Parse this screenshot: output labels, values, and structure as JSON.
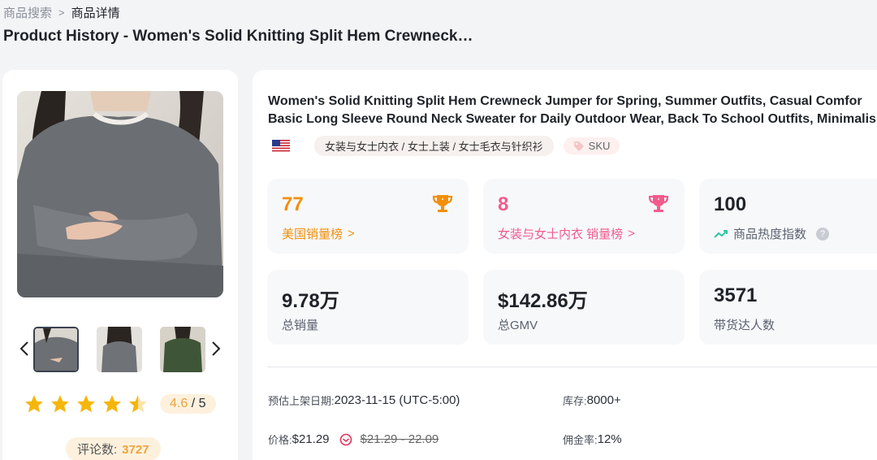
{
  "breadcrumb": {
    "parent": "商品搜索",
    "separator": ">",
    "current": "商品详情"
  },
  "page_title": "Product History - Women's Solid Knitting Split Hem Crewneck…",
  "gallery": {
    "rating": "4.6",
    "rating_total": "/ 5",
    "stars_filled": 4.5,
    "review_label": "评论数:",
    "review_count": "3727",
    "thumb_count": 3,
    "active_thumb_index": 0,
    "star_color": "#f5b60a"
  },
  "product": {
    "name_line1": "Women's Solid Knitting Split Hem Crewneck Jumper for Spring, Summer Outfits, Casual Comfor",
    "name_line2": "Basic Long Sleeve Round Neck Sweater for Daily Outdoor Wear, Back To School Outfits, Minimalis",
    "flag": "us-flag-icon",
    "category": "女装与女士内衣 / 女士上装 / 女士毛衣与针织衫",
    "sku_label": "SKU"
  },
  "stats": {
    "rank_us": {
      "value": "77",
      "label": "美国销量榜",
      "arrow": ">",
      "color": "#f38f0c"
    },
    "rank_category": {
      "value": "8",
      "label": "女装与女士内衣 销量榜",
      "arrow": ">",
      "color": "#f25c8c"
    },
    "heat": {
      "value": "100",
      "label": "商品热度指数",
      "help": "?"
    },
    "total_sales": {
      "value": "9.78万",
      "label": "总销量"
    },
    "total_gmv": {
      "value": "$142.86万",
      "label": "总GMV"
    },
    "influencers": {
      "value": "3571",
      "label": "带货达人数"
    }
  },
  "info": {
    "listing_date_key": "预估上架日期:",
    "listing_date_value": "2023-11-15 (UTC-5:00)",
    "stock_key": "库存:",
    "stock_value": "8000+",
    "price_key": "价格:",
    "price_value": "$21.29",
    "price_original": "$21.29 - 22.09",
    "commission_key": "佣金率:",
    "commission_value": "12%"
  }
}
